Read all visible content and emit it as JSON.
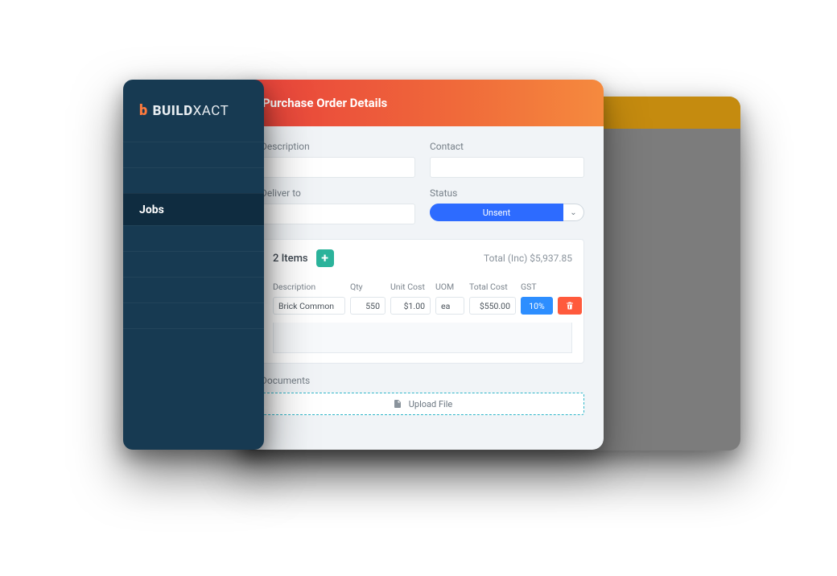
{
  "brand": {
    "prefix": "BUILD",
    "suffix": "XACT"
  },
  "sidebar": {
    "active_label": "Jobs"
  },
  "header": {
    "title": "Purchase Order Details"
  },
  "fields": {
    "description_label": "Description",
    "contact_label": "Contact",
    "deliver_to_label": "Deliver to",
    "status_label": "Status",
    "status_value": "Unsent"
  },
  "items": {
    "count_label": "2 Items",
    "total_label": "Total (Inc) $5,937.85",
    "columns": {
      "description": "Description",
      "qty": "Qty",
      "unit_cost": "Unit Cost",
      "uom": "UOM",
      "total_cost": "Total Cost",
      "gst": "GST"
    },
    "row": {
      "description": "Brick Common",
      "qty": "550",
      "unit_cost": "$1.00",
      "uom": "ea",
      "total_cost": "$550.00",
      "gst": "10%"
    }
  },
  "documents": {
    "label": "Documents",
    "upload_label": "Upload File"
  }
}
